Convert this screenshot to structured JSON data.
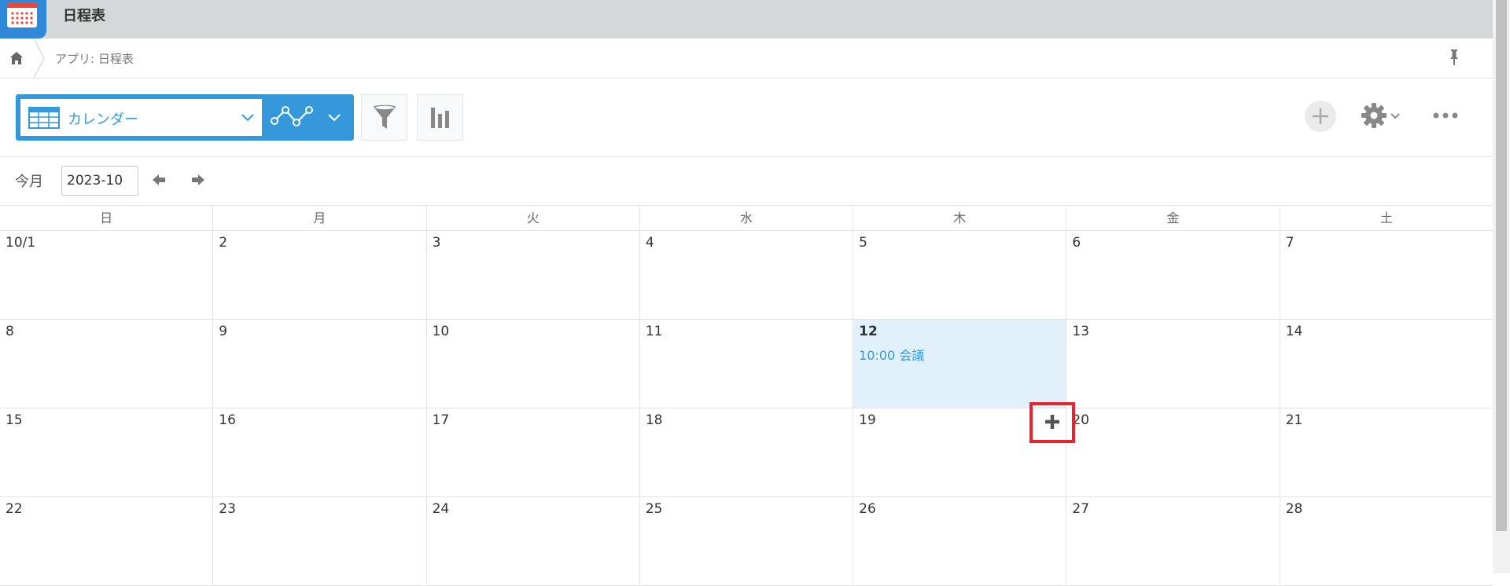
{
  "app": {
    "title": "日程表"
  },
  "breadcrumb": {
    "text": "アプリ: 日程表"
  },
  "toolbar": {
    "view_label": "カレンダー"
  },
  "nav": {
    "this_month": "今月",
    "month_value": "2023-10"
  },
  "calendar": {
    "weekdays": [
      "日",
      "月",
      "火",
      "水",
      "木",
      "金",
      "土"
    ],
    "weeks": [
      [
        "10/1",
        "2",
        "3",
        "4",
        "5",
        "6",
        "7"
      ],
      [
        "8",
        "9",
        "10",
        "11",
        "12",
        "13",
        "14"
      ],
      [
        "15",
        "16",
        "17",
        "18",
        "19",
        "20",
        "21"
      ],
      [
        "22",
        "23",
        "24",
        "25",
        "26",
        "27",
        "28"
      ]
    ],
    "event": {
      "text": "10:00 会議"
    }
  },
  "colors": {
    "accent": "#3498db",
    "today_bg": "#e1f1fc",
    "highlight": "#e8232e",
    "topbar": "#d5d8d9"
  }
}
